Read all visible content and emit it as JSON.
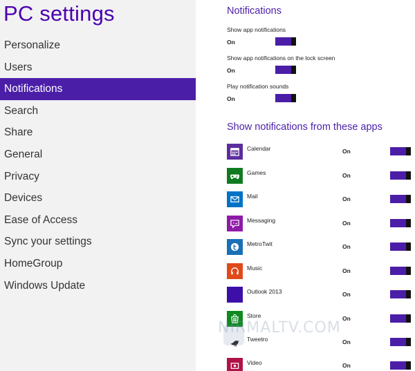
{
  "app_title": "PC settings",
  "nav": [
    {
      "label": "Personalize",
      "selected": false
    },
    {
      "label": "Users",
      "selected": false
    },
    {
      "label": "Notifications",
      "selected": true
    },
    {
      "label": "Search",
      "selected": false
    },
    {
      "label": "Share",
      "selected": false
    },
    {
      "label": "General",
      "selected": false
    },
    {
      "label": "Privacy",
      "selected": false
    },
    {
      "label": "Devices",
      "selected": false
    },
    {
      "label": "Ease of Access",
      "selected": false
    },
    {
      "label": "Sync your settings",
      "selected": false
    },
    {
      "label": "HomeGroup",
      "selected": false
    },
    {
      "label": "Windows Update",
      "selected": false
    }
  ],
  "notifications": {
    "title": "Notifications",
    "settings": [
      {
        "label": "Show app notifications",
        "state": "On"
      },
      {
        "label": "Show app notifications on the lock screen",
        "state": "On"
      },
      {
        "label": "Play notification sounds",
        "state": "On"
      }
    ]
  },
  "apps_section": {
    "title": "Show notifications from these apps",
    "apps": [
      {
        "name": "Calendar",
        "state": "On",
        "icon": "calendar-icon",
        "color": "#5b2d9f"
      },
      {
        "name": "Games",
        "state": "On",
        "icon": "games-icon",
        "color": "#0f7b1f"
      },
      {
        "name": "Mail",
        "state": "On",
        "icon": "mail-icon",
        "color": "#0072c6"
      },
      {
        "name": "Messaging",
        "state": "On",
        "icon": "messaging-icon",
        "color": "#8e1aa8"
      },
      {
        "name": "MetroTwit",
        "state": "On",
        "icon": "metrotwit-icon",
        "color": "#1a6fb5"
      },
      {
        "name": "Music",
        "state": "On",
        "icon": "music-icon",
        "color": "#e04a1b"
      },
      {
        "name": "Outlook 2013",
        "state": "On",
        "icon": "outlook-icon",
        "color": "#3d0fa8"
      },
      {
        "name": "Store",
        "state": "On",
        "icon": "store-icon",
        "color": "#0e8a1e"
      },
      {
        "name": "Tweetro",
        "state": "On",
        "icon": "tweetro-icon",
        "color": "#ffffff"
      },
      {
        "name": "Video",
        "state": "On",
        "icon": "video-icon",
        "color": "#b01248"
      }
    ]
  },
  "watermark": "NIRMALTV.COM",
  "colors": {
    "accent": "#4b1ea8",
    "left_pane_bg": "#f2f2f2"
  }
}
